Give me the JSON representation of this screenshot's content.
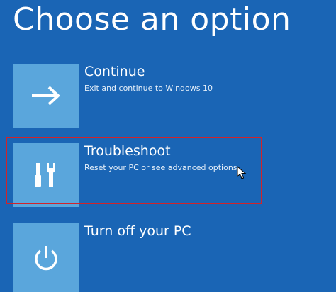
{
  "page": {
    "title": "Choose an option"
  },
  "options": [
    {
      "title": "Continue",
      "description": "Exit and continue to Windows 10",
      "icon": "arrow-right-icon"
    },
    {
      "title": "Troubleshoot",
      "description": "Reset your PC or see advanced options",
      "icon": "tools-icon",
      "highlighted": true
    },
    {
      "title": "Turn off your PC",
      "description": "",
      "icon": "power-icon"
    }
  ],
  "colors": {
    "background": "#1a65b5",
    "tile": "#5aa6dc",
    "highlight": "#d2232a",
    "text": "#ffffff"
  }
}
